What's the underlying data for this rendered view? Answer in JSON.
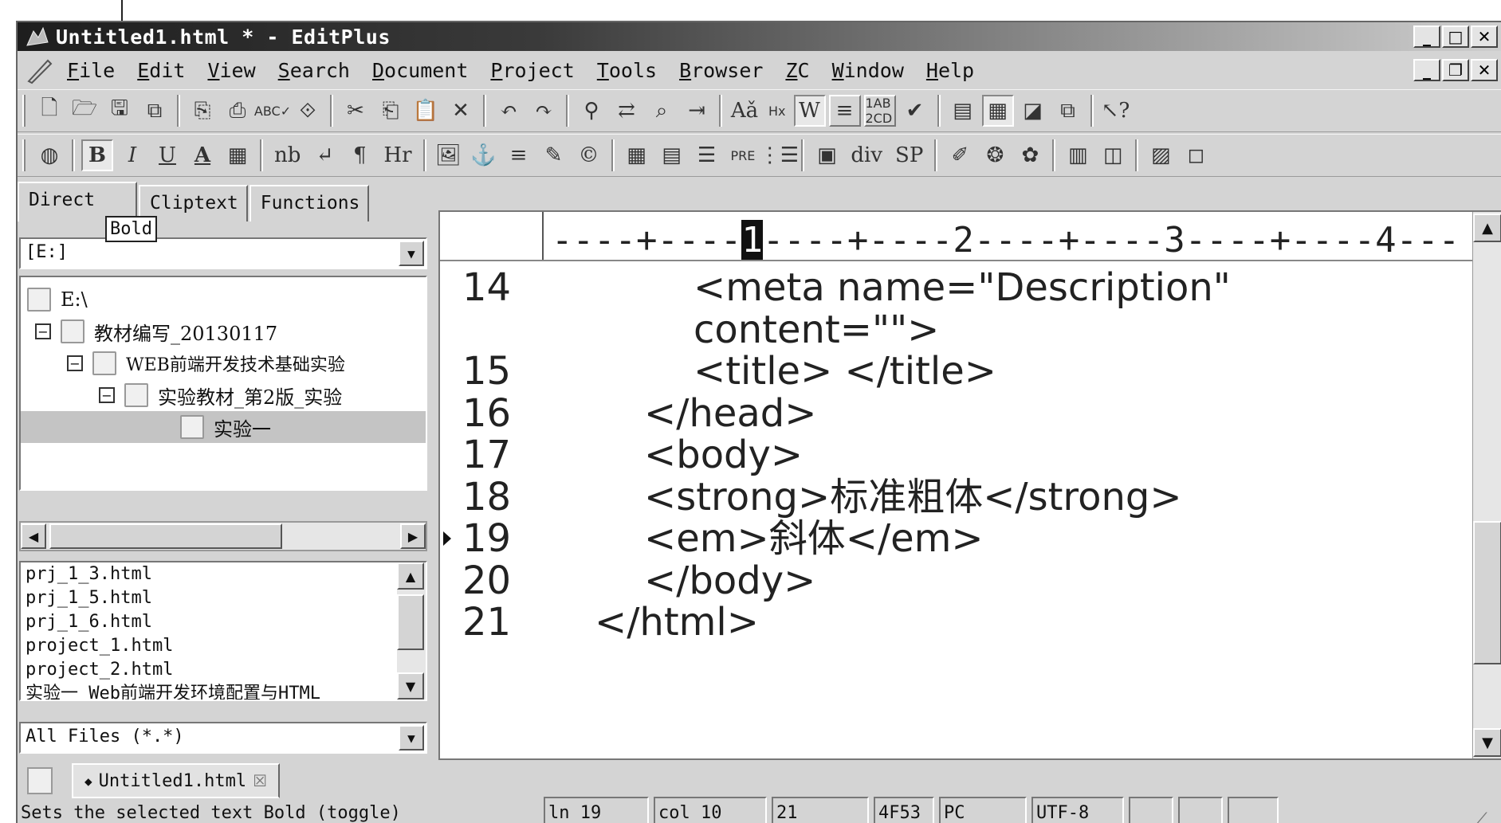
{
  "window": {
    "title": "Untitled1.html * - EditPlus"
  },
  "menu": [
    {
      "label": "File",
      "ul": "F",
      "rest": "ile"
    },
    {
      "label": "Edit",
      "ul": "E",
      "rest": "dit"
    },
    {
      "label": "View",
      "ul": "V",
      "rest": "iew"
    },
    {
      "label": "Search",
      "ul": "S",
      "rest": "earch"
    },
    {
      "label": "Document",
      "ul": "D",
      "rest": "ocument"
    },
    {
      "label": "Project",
      "ul": "P",
      "rest": "roject"
    },
    {
      "label": "Tools",
      "ul": "T",
      "rest": "ools"
    },
    {
      "label": "Browser",
      "ul": "B",
      "rest": "rowser"
    },
    {
      "label": "ZC",
      "ul": "Z",
      "rest": "C"
    },
    {
      "label": "Window",
      "ul": "W",
      "rest": "indow"
    },
    {
      "label": "Help",
      "ul": "H",
      "rest": "elp"
    }
  ],
  "toolbar2": {
    "bold": "B",
    "italic": "I",
    "underline": "U",
    "fontcolor": "A",
    "nbsp": "nb",
    "hr": "Hr",
    "pre": "PRE",
    "div": "div",
    "span": "SP"
  },
  "toolbar1": {
    "font_size": "Hx",
    "abcd": "1AB 2CD"
  },
  "sidebar": {
    "tabs": [
      "Directory",
      "Cliptext",
      "Functions"
    ],
    "tab_visible": "Direct",
    "tooltip": "Bold",
    "drive": "[E:]",
    "tree": [
      {
        "label": "E:\\",
        "level": 0
      },
      {
        "label": "教材编写_20130117",
        "level": 1
      },
      {
        "label": "WEB前端开发技术基础实验",
        "level": 2
      },
      {
        "label": "实验教材_第2版_实验",
        "level": 3
      },
      {
        "label": "实验一",
        "level": 4,
        "selected": true
      }
    ],
    "files": [
      "prj_1_3.html",
      "prj_1_5.html",
      "prj_1_6.html",
      "project_1.html",
      "project_2.html",
      "实验一 Web前端开发环境配置与HTML"
    ],
    "filter": "All Files (*.*)"
  },
  "editor": {
    "ruler": "----+----1----+----2----+----3----+----4---",
    "ruler_before": "----+----",
    "ruler_caret": "1",
    "ruler_after": "----+----2----+----3----+----4---",
    "lines": [
      {
        "num": "14",
        "text": "<meta name=\"Description\"",
        "indent": 3
      },
      {
        "num": "",
        "text": "content=\"\">",
        "indent": 3
      },
      {
        "num": "15",
        "text": "<title>  </title>",
        "indent": 3
      },
      {
        "num": "16",
        "text": "</head>",
        "indent": 2
      },
      {
        "num": "17",
        "text": "<body>",
        "indent": 2
      },
      {
        "num": "18",
        "text": "<strong>标准粗体</strong>",
        "indent": 2
      },
      {
        "num": "19",
        "text": "<em>斜体</em>",
        "indent": 2,
        "current": true
      },
      {
        "num": "20",
        "text": "</body>",
        "indent": 2
      },
      {
        "num": "21",
        "text": "</html>",
        "indent": 1
      }
    ]
  },
  "doc_tab": {
    "label": "Untitled1.html",
    "modified_mark": "◆"
  },
  "status": {
    "message": "Sets the selected text Bold (toggle)",
    "line": "ln 19",
    "col": "col 10",
    "lines": "21",
    "code": "4F53",
    "format": "PC",
    "encoding": "UTF-8"
  }
}
